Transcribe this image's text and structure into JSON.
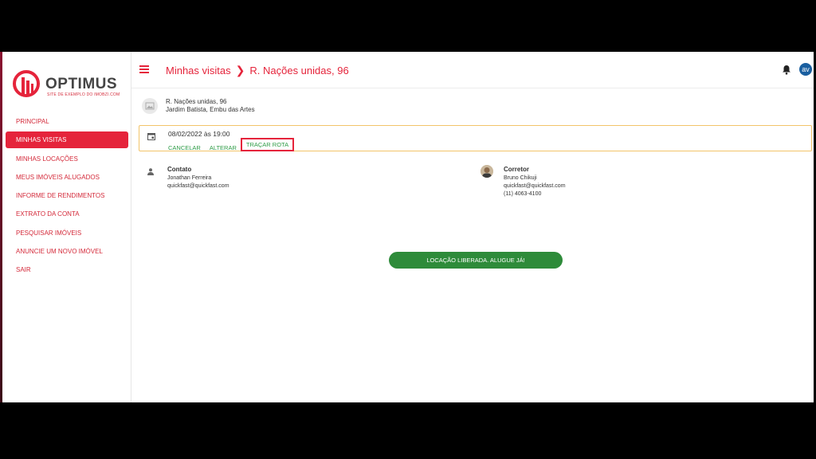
{
  "brand": {
    "name": "OPTIMUS",
    "tagline": "SITE DE EXEMPLO DO IMOBZI.COM",
    "accent": "#e5243b"
  },
  "sidebar": {
    "items": [
      {
        "label": "PRINCIPAL"
      },
      {
        "label": "MINHAS VISITAS",
        "active": true
      },
      {
        "label": "MINHAS LOCAÇÕES"
      },
      {
        "label": "MEUS IMÓVEIS ALUGADOS"
      },
      {
        "label": "INFORME DE RENDIMENTOS"
      },
      {
        "label": "EXTRATO DA CONTA"
      },
      {
        "label": "PESQUISAR IMÓVEIS"
      },
      {
        "label": "ANUNCIE UM NOVO IMÓVEL"
      },
      {
        "label": "SAIR"
      }
    ]
  },
  "header": {
    "breadcrumb_1": "Minhas visitas",
    "breadcrumb_2": "R. Nações unidas, 96",
    "avatar_initial": "av"
  },
  "property": {
    "address": "R. Nações unidas, 96",
    "district": "Jardim Batista, Embu das Artes"
  },
  "visit": {
    "datetime": "08/02/2022 às 19:00",
    "cancel_label": "CANCELAR",
    "change_label": "ALTERAR",
    "route_label": "TRAÇAR ROTA"
  },
  "contact": {
    "title": "Contato",
    "name": "Jonathan Ferreira",
    "email": "quickfast@quickfast.com"
  },
  "broker": {
    "title": "Corretor",
    "name": "Bruno Chikuji",
    "email": "quickfast@quickfast.com",
    "phone": "(11) 4063-4100"
  },
  "cta": {
    "label": "LOCAÇÃO LIBERADA. ALUGUE JÁ!",
    "color": "#2e8b3a"
  }
}
